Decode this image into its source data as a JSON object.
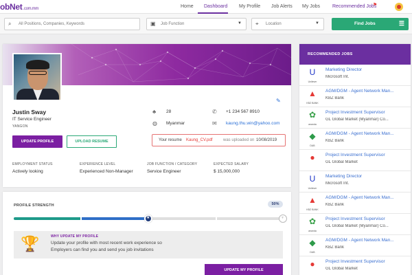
{
  "nav": {
    "logo": "obNet",
    "logo_domain": ".com.mm",
    "links": [
      "Home",
      "Dashboard",
      "My Profile",
      "Job Alerts",
      "My Jobs",
      "Recommended Jobs"
    ],
    "active": "Dashboard",
    "flag_icon": "flag-icon",
    "accent": "#6b2fa0"
  },
  "search": {
    "keyword_placeholder": "All Positions, Companies, Keywords",
    "function_placeholder": "Job Function",
    "location_placeholder": "Location",
    "find_label": "Find Jobs",
    "find_color": "#2aa876"
  },
  "profile": {
    "name": "Justin Sway",
    "title": "IT Service Engineer",
    "location": "YANGON",
    "age": "28",
    "nationality": "Myanmar",
    "phone": "+1 234 567 8910",
    "email": "kaung.thu.win@yahoo.com",
    "update_btn": "UPDATE PROFILE",
    "upload_btn": "UPLOAD RESUME",
    "resume_prefix": "Your resume",
    "resume_file": "Kaung_CV.pdf",
    "resume_mid": "was uploaded on",
    "resume_date": "10/08/2019",
    "stats": [
      {
        "label": "EMPLOYMENT STATUS",
        "value": "Actively looking"
      },
      {
        "label": "EXPERIENCE LEVEL",
        "value": "Experienced Non-Manager"
      },
      {
        "label": "JOB FUNCTION / CATEGORY",
        "value": "Service Engineer"
      },
      {
        "label": "EXPECTED SALARY",
        "value": "$ 15,000,000"
      }
    ]
  },
  "strength": {
    "title": "PROFILE STRENGTH",
    "percent": "50%",
    "progress": 0.5,
    "tip_heading": "WHY UPDATE MY PROFILE",
    "tip_line1": "Update your profile with most recent work experience so",
    "tip_line2": "Employers can find you and send you job invitations",
    "update_btn": "UPDATE MY PROFILE"
  },
  "recommended": {
    "heading": "RECOMMENDED JOBS",
    "jobs": [
      {
        "title": "Marketing Director",
        "company": "Microsoft Int.",
        "logo": "unilever-logo",
        "caption": "Unilever"
      },
      {
        "title": "AGM/DGM - Agent Network Man...",
        "company": "KBZ Bank",
        "logo": "kbz-logo",
        "caption": "KBZ BANK"
      },
      {
        "title": "Project Investment Supervisor",
        "company": "GL Global Market (Myanmar) Co...",
        "logo": "ananda-logo",
        "caption": "ananda"
      },
      {
        "title": "AGM/DGM - Agent Network Man...",
        "company": "KBZ Bank",
        "logo": "dab-logo",
        "caption": "DAB"
      },
      {
        "title": "Project Investment Supervisor",
        "company": "GL Global Market",
        "logo": "gl-logo",
        "caption": ""
      },
      {
        "title": "Marketing Director",
        "company": "Microsoft Int.",
        "logo": "unilever-logo",
        "caption": "Unilever"
      },
      {
        "title": "AGM/DGM - Agent Network Man...",
        "company": "KBZ Bank",
        "logo": "kbz-logo",
        "caption": "KBZ BANK"
      },
      {
        "title": "Project Investment Supervisor",
        "company": "GL Global Market (Myanmar) Co...",
        "logo": "ananda-logo",
        "caption": "ananda"
      },
      {
        "title": "AGM/DGM - Agent Network Man...",
        "company": "KBZ Bank",
        "logo": "dab-logo",
        "caption": "DAB"
      },
      {
        "title": "Project Investment Supervisor",
        "company": "GL Global Market",
        "logo": "gl-logo",
        "caption": ""
      }
    ]
  }
}
